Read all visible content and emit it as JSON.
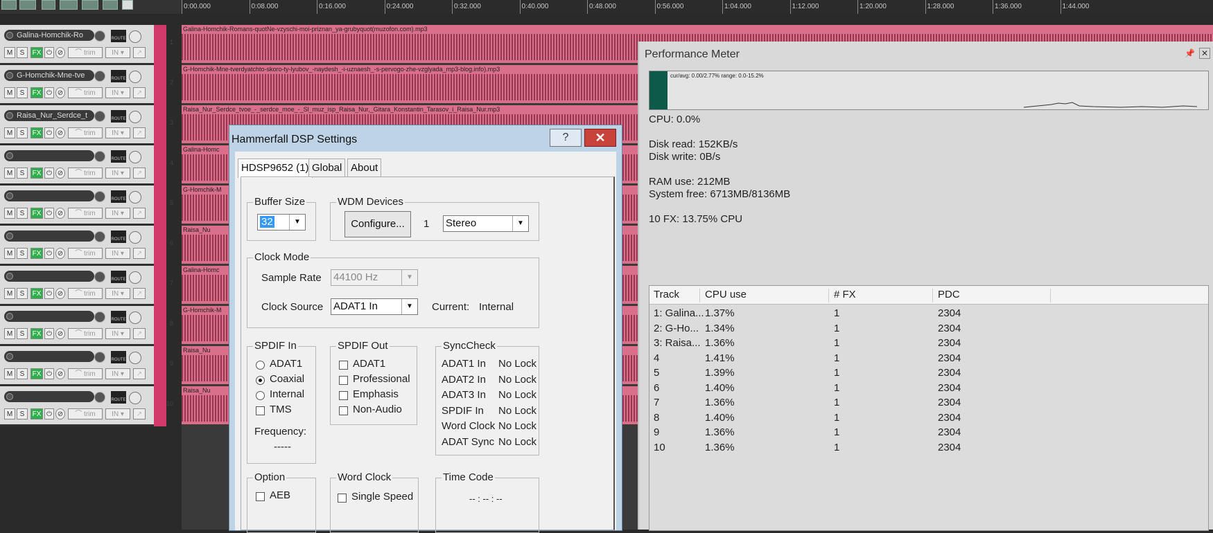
{
  "ruler": {
    "ticks": [
      "0:00.000",
      "0:08.000",
      "0:16.000",
      "0:24.000",
      "0:32.000",
      "0:40.000",
      "0:48.000",
      "0:56.000",
      "1:04.000",
      "1:12.000",
      "1:20.000",
      "1:28.000",
      "1:36.000",
      "1:44.000"
    ]
  },
  "tracks": [
    {
      "num": "1",
      "name": "Galina-Homchik-Ro",
      "clip": "Galina-Homchik-Romans-quotNe-vzyschi-moi-priznan_ya-grubyquot(muzofon.com).mp3"
    },
    {
      "num": "2",
      "name": "G-Homchik-Mne-tve",
      "clip": "G-Homchik-Mne-tverdyatchto-skoro-ty-lyubov_-naydesh_-i-uznaesh_-s-pervogo-zhe-vzglyada_mp3-blog.info).mp3"
    },
    {
      "num": "3",
      "name": "Raisa_Nur_Serdce_t",
      "clip": "Raisa_Nur_Serdce_tvoe_-_serdce_moe_-_Sl_muz_isp_Raisa_Nur,_Gitara_Konstantin_Tarasov_i_Raisa_Nur.mp3"
    },
    {
      "num": "4",
      "name": "",
      "clip": "Galina-Homc"
    },
    {
      "num": "5",
      "name": "",
      "clip": "G-Homchik-M"
    },
    {
      "num": "6",
      "name": "",
      "clip": "Raisa_Nu"
    },
    {
      "num": "7",
      "name": "",
      "clip": "Galina-Homc"
    },
    {
      "num": "8",
      "name": "",
      "clip": "G-Homchik-M"
    },
    {
      "num": "9",
      "name": "",
      "clip": "Raisa_Nu"
    },
    {
      "num": "10",
      "name": "",
      "clip": "Raisa_Nu"
    }
  ],
  "track_buttons": {
    "mute": "M",
    "solo": "S",
    "fx": "FX",
    "trim": "trim",
    "input": "IN",
    "route": "ROUTE"
  },
  "perf": {
    "title": "Performance Meter",
    "graph_label": "cur/avg: 0.00/2.77%  range: 0.0-15.2%",
    "cpu": "CPU: 0.0%",
    "disk_read": "Disk read: 152KB/s",
    "disk_write": "Disk write: 0B/s",
    "ram": "RAM use: 212MB",
    "sys_free": "System free: 6713MB/8136MB",
    "fx": "10 FX: 13.75% CPU",
    "columns": [
      "Track",
      "CPU use",
      "# FX",
      "PDC"
    ],
    "rows": [
      [
        "1: Galina...",
        "1.37%",
        "1",
        "2304"
      ],
      [
        "2: G-Ho...",
        "1.34%",
        "1",
        "2304"
      ],
      [
        "3: Raisa...",
        "1.36%",
        "1",
        "2304"
      ],
      [
        "4",
        "1.41%",
        "1",
        "2304"
      ],
      [
        "5",
        "1.39%",
        "1",
        "2304"
      ],
      [
        "6",
        "1.40%",
        "1",
        "2304"
      ],
      [
        "7",
        "1.36%",
        "1",
        "2304"
      ],
      [
        "8",
        "1.40%",
        "1",
        "2304"
      ],
      [
        "9",
        "1.36%",
        "1",
        "2304"
      ],
      [
        "10",
        "1.36%",
        "1",
        "2304"
      ]
    ]
  },
  "dialog": {
    "title": "Hammerfall DSP Settings",
    "help": "?",
    "close": "✕",
    "tabs": [
      "HDSP9652 (1)",
      "Global",
      "About"
    ],
    "buffer_size": {
      "label": "Buffer Size",
      "value": "32"
    },
    "wdm": {
      "label": "WDM Devices",
      "configure": "Configure...",
      "count": "1",
      "mode": "Stereo"
    },
    "clock_mode": {
      "label": "Clock Mode",
      "sample_rate_label": "Sample Rate",
      "sample_rate": "44100 Hz",
      "clock_source_label": "Clock Source",
      "clock_source": "ADAT1 In",
      "current_label": "Current:",
      "current": "Internal"
    },
    "spdif_in": {
      "label": "SPDIF In",
      "options": [
        "ADAT1",
        "Coaxial",
        "Internal"
      ],
      "tms": "TMS",
      "freq_label": "Frequency:",
      "freq": "-----"
    },
    "spdif_out": {
      "label": "SPDIF Out",
      "options": [
        "ADAT1",
        "Professional",
        "Emphasis",
        "Non-Audio"
      ]
    },
    "synccheck": {
      "label": "SyncCheck",
      "rows": [
        [
          "ADAT1 In",
          "No Lock"
        ],
        [
          "ADAT2 In",
          "No Lock"
        ],
        [
          "ADAT3 In",
          "No Lock"
        ],
        [
          "SPDIF In",
          "No Lock"
        ],
        [
          "Word Clock",
          "No Lock"
        ],
        [
          "ADAT Sync",
          "No Lock"
        ]
      ]
    },
    "option": {
      "label": "Option",
      "aeb": "AEB"
    },
    "word_clock": {
      "label": "Word Clock",
      "single_speed": "Single Speed"
    },
    "time_code": {
      "label": "Time Code",
      "value": "-- : -- : --"
    }
  }
}
